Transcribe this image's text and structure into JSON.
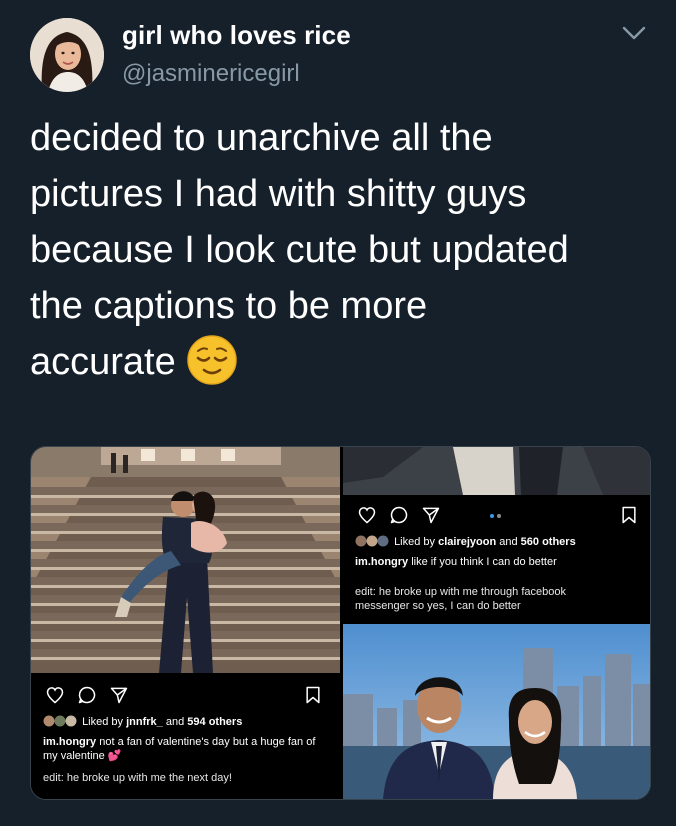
{
  "author": {
    "display_name": "girl who loves rice",
    "handle": "@jasminericegirl",
    "avatar_icon": "profile-photo",
    "menu_icon": "chevron-down-icon"
  },
  "tweet": {
    "text": "decided to unarchive all the\npictures I had with shitty guys\nbecause I look cute but updated\nthe captions to be more\naccurate",
    "emoji": "relieved-face-emoji"
  },
  "media": {
    "left_post": {
      "liked_prefix": "Liked by",
      "liked_user": "jnnfrk_",
      "liked_suffix": "and",
      "liked_count": "594 others",
      "caption_user": "im.hongry",
      "caption_text": "not a fan of valentine's day but a huge fan of my valentine 💕",
      "edit_text": "edit: he broke up with me the next day!"
    },
    "right_post": {
      "liked_prefix": "Liked by",
      "liked_user": "clairejyoon",
      "liked_suffix": "and",
      "liked_count": "560 others",
      "caption_user": "im.hongry",
      "caption_text": "like if you think I can do better",
      "edit_text": "edit: he broke up with me through facebook messenger so yes, I can do better"
    }
  },
  "colors": {
    "background": "#15202b",
    "secondary_text": "#8899a6",
    "border": "#38444d"
  }
}
